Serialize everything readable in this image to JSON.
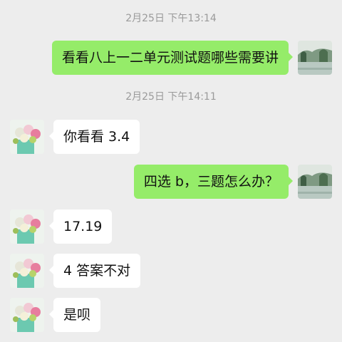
{
  "chat": {
    "timestamps": [
      "2月25日 下午13:14",
      "2月25日 下午14:11"
    ],
    "messages": [
      {
        "from": "me",
        "text": "看看八上一二单元测试题哪些需要讲"
      },
      {
        "from": "other",
        "text": "你看看 3.4"
      },
      {
        "from": "me",
        "text": "四选 b，三题怎么办？"
      },
      {
        "from": "other",
        "text": "17.19"
      },
      {
        "from": "other",
        "text": "4 答案不对"
      },
      {
        "from": "other",
        "text": "是呗"
      }
    ]
  },
  "colors": {
    "background": "#ededed",
    "outgoing_bubble": "#95ec69",
    "incoming_bubble": "#ffffff",
    "timestamp_text": "#9a9a9a"
  },
  "icons": {
    "my_avatar": "landscape-avatar",
    "contact_avatar": "flower-avatar"
  }
}
